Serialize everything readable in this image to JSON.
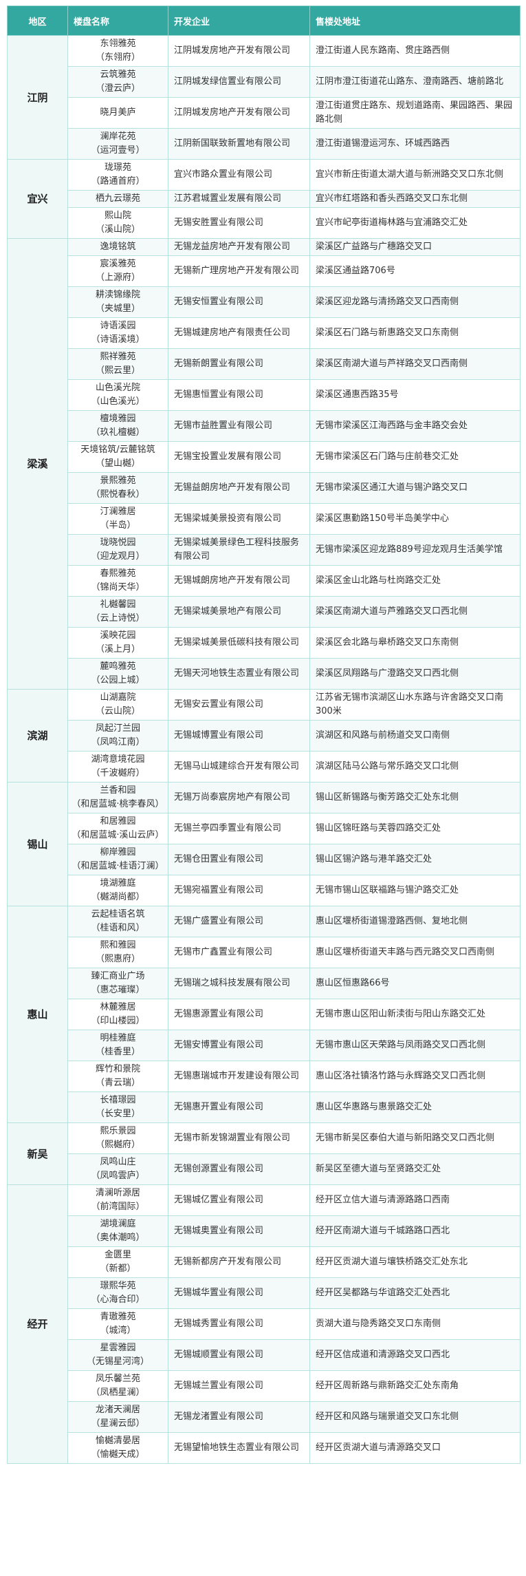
{
  "header": {
    "region": "地区",
    "name": "楼盘名称",
    "developer": "开发企业",
    "address": "售楼处地址"
  },
  "groups": [
    {
      "region": "江阴",
      "rows": [
        {
          "name": [
            "东翎雅苑",
            "（东翎府）"
          ],
          "developer": "江阴城发房地产开发有限公司",
          "address": "澄江街道人民东路南、贯庄路西侧"
        },
        {
          "name": [
            "云筑雅苑",
            "（澄云庐）"
          ],
          "developer": "江阴城发绿信置业有限公司",
          "address": "江阴市澄江街道花山路东、澄南路西、塘前路北"
        },
        {
          "name": [
            "晓月美庐"
          ],
          "developer": "江阴城发房地产开发有限公司",
          "address": "澄江街道贯庄路东、规划道路南、果园路西、果园路北侧"
        },
        {
          "name": [
            "澜岸花苑",
            "（运河壹号）"
          ],
          "developer": "江阴新国联致新置地有限公司",
          "address": "澄江街道锡澄运河东、环城西路西"
        }
      ]
    },
    {
      "region": "宜兴",
      "rows": [
        {
          "name": [
            "珑璟苑",
            "（路通首府）"
          ],
          "developer": "宜兴市路众置业有限公司",
          "address": "宜兴市新庄街道太湖大道与新洲路交叉口东北侧"
        },
        {
          "name": [
            "栖九云璟苑"
          ],
          "developer": "江苏君城置业发展有限公司",
          "address": "宜兴市红塔路和香头西路交叉口东北侧"
        },
        {
          "name": [
            "熙山院",
            "（溪山院）"
          ],
          "developer": "无锡安胜置业有限公司",
          "address": "宜兴市屺亭街道梅林路与宜浦路交汇处"
        }
      ]
    },
    {
      "region": "梁溪",
      "rows": [
        {
          "name": [
            "逸境铭筑"
          ],
          "developer": "无锡龙益房地产开发有限公司",
          "address": "梁溪区广益路与广穗路交叉口"
        },
        {
          "name": [
            "宸溪雅苑",
            "（上源府）"
          ],
          "developer": "无锡新广理房地产开发有限公司",
          "address": "梁溪区通益路706号"
        },
        {
          "name": [
            "耕渎锦缘院",
            "（夹城里）"
          ],
          "developer": "无锡安恒置业有限公司",
          "address": "梁溪区迎龙路与清扬路交叉口西南侧"
        },
        {
          "name": [
            "诗语溪园",
            "（诗语溪境）"
          ],
          "developer": "无锡城建房地产有限责任公司",
          "address": "梁溪区石门路与新惠路交叉口东南侧"
        },
        {
          "name": [
            "熙祥雅苑",
            "（熙云里）"
          ],
          "developer": "无锡新朗置业有限公司",
          "address": "梁溪区南湖大道与芦祥路交叉口西南侧"
        },
        {
          "name": [
            "山色溪光院",
            "（山色溪光）"
          ],
          "developer": "无锡惠恒置业有限公司",
          "address": "梁溪区通惠西路35号"
        },
        {
          "name": [
            "檀境雅园",
            "（玖礼檀樾）"
          ],
          "developer": "无锡市益胜置业有限公司",
          "address": "无锡市梁溪区江海西路与金丰路交会处"
        },
        {
          "name": [
            "天境铭筑/云麓铭筑",
            "（望山樾）"
          ],
          "developer": "无锡宝投置业发展有限公司",
          "address": "无锡市梁溪区石门路与庄前巷交汇处"
        },
        {
          "name": [
            "景熙雅苑",
            "（熙悦春秋）"
          ],
          "developer": "无锡益朗房地产开发有限公司",
          "address": "无锡市梁溪区通江大道与锡沪路交叉口"
        },
        {
          "name": [
            "汀澜雅居",
            "（半岛）"
          ],
          "developer": "无锡梁城美景投资有限公司",
          "address": "梁溪区惠勤路150号半岛美学中心"
        },
        {
          "name": [
            "珑晓悦园",
            "（迎龙观月）"
          ],
          "developer": "无锡梁城美景绿色工程科技服务有限公司",
          "address": "无锡市梁溪区迎龙路889号迎龙观月生活美学馆"
        },
        {
          "name": [
            "春熙雅苑",
            "（锦尚天华）"
          ],
          "developer": "无锡城朗房地产开发有限公司",
          "address": "梁溪区金山北路与杜岗路交汇处"
        },
        {
          "name": [
            "礼樾馨园",
            "（云上诗悦）"
          ],
          "developer": "无锡梁城美景地产有限公司",
          "address": "梁溪区南湖大道与芦雅路交叉口西北侧"
        },
        {
          "name": [
            "溪映花园",
            "（溪上月）"
          ],
          "developer": "无锡梁城美景低碳科技有限公司",
          "address": "梁溪区会北路与皋桥路交叉口东南侧"
        },
        {
          "name": [
            "麓鸣雅苑",
            "（公园上城）"
          ],
          "developer": "无锡天河地铁生态置业有限公司",
          "address": "梁溪区凤翔路与广澄路交叉口西北侧"
        }
      ]
    },
    {
      "region": "滨湖",
      "rows": [
        {
          "name": [
            "山湖嘉院",
            "（云山院）"
          ],
          "developer": "无锡安云置业有限公司",
          "address": "江苏省无锡市滨湖区山水东路与许舍路交叉口南300米"
        },
        {
          "name": [
            "凤起汀兰园",
            "（凤鸣江南）"
          ],
          "developer": "无锡城博置业有限公司",
          "address": "滨湖区和风路与前杨道交叉口南侧"
        },
        {
          "name": [
            "湖湾意境花园",
            "（千波樾府）"
          ],
          "developer": "无锡马山城建综合开发有限公司",
          "address": "滨湖区陆马公路与常乐路交叉口北侧"
        }
      ]
    },
    {
      "region": "锡山",
      "rows": [
        {
          "name": [
            "兰香和园",
            "（和居蓝城·桃李春风）"
          ],
          "developer": "无锡万尚泰宸房地产有限公司",
          "address": "锡山区新锡路与衡芳路交汇处东北侧"
        },
        {
          "name": [
            "和居雅园",
            "（和居蓝城·溪山云庐）"
          ],
          "developer": "无锡兰亭四季置业有限公司",
          "address": "锡山区锦旺路与芙蓉四路交汇处"
        },
        {
          "name": [
            "柳岸雅园",
            "（和居蓝城·桂语汀澜）"
          ],
          "developer": "无锡仓田置业有限公司",
          "address": "锡山区锡沪路与港羊路交汇处"
        },
        {
          "name": [
            "境湖雅庭",
            "（樾湖尚都）"
          ],
          "developer": "无锡宛福置业有限公司",
          "address": "无锡市锡山区联福路与锡沪路交汇处"
        }
      ]
    },
    {
      "region": "惠山",
      "rows": [
        {
          "name": [
            "云起桂语名筑",
            "（桂语和风）"
          ],
          "developer": "无锡广盛置业有限公司",
          "address": "惠山区堰桥街道锡澄路西侧、复地北侧"
        },
        {
          "name": [
            "熙和雅园",
            "（熙惠府）"
          ],
          "developer": "无锡市广鑫置业有限公司",
          "address": "惠山区堰桥街道天丰路与西元路交叉口西南侧"
        },
        {
          "name": [
            "臻汇商业广场",
            "（惠芯璀璨）"
          ],
          "developer": "无锡瑞之城科技发展有限公司",
          "address": "惠山区恒惠路66号"
        },
        {
          "name": [
            "林麓雅居",
            "（印山楼园）"
          ],
          "developer": "无锡惠源置业有限公司",
          "address": "无锡市惠山区阳山新渎街与阳山东路交汇处"
        },
        {
          "name": [
            "明桂雅庭",
            "（桂香里）"
          ],
          "developer": "无锡安博置业有限公司",
          "address": "无锡市惠山区天荣路与凤雨路交叉口西北侧"
        },
        {
          "name": [
            "辉竹和景院",
            "（青云瑞）"
          ],
          "developer": "无锡惠瑞城市开发建设有限公司",
          "address": "惠山区洛社镇洛竹路与永辉路交叉口西北侧"
        },
        {
          "name": [
            "长禧璟园",
            "（长安里）"
          ],
          "developer": "无锡惠开置业有限公司",
          "address": "惠山区华惠路与惠景路交汇处"
        }
      ]
    },
    {
      "region": "新吴",
      "rows": [
        {
          "name": [
            "熙乐景园",
            "（熙樾府）"
          ],
          "developer": "无锡市新发锦湖置业有限公司",
          "address": "无锡市新吴区泰伯大道与新阳路交叉口西北侧"
        },
        {
          "name": [
            "凤鸣山庄",
            "（凤鸣雲庐）"
          ],
          "developer": "无锡创源置业有限公司",
          "address": "新吴区至德大道与至贤路交汇处"
        }
      ]
    },
    {
      "region": "经开",
      "rows": [
        {
          "name": [
            "清澜听源居",
            "（前湾国际）"
          ],
          "developer": "无锡城亿置业有限公司",
          "address": "经开区立信大道与清源路路口西南"
        },
        {
          "name": [
            "湖境澜庭",
            "（奥体潮鸣）"
          ],
          "developer": "无锡城奥置业有限公司",
          "address": "经开区南湖大道与千城路路口西北"
        },
        {
          "name": [
            "金匮里",
            "（新都）"
          ],
          "developer": "无锡新都房产开发有限公司",
          "address": "经开区贡湖大道与壤铁桥路交汇处东北"
        },
        {
          "name": [
            "璟熙华苑",
            "（心海合印）"
          ],
          "developer": "无锡城华置业有限公司",
          "address": "经开区吴都路与华谊路交汇处西北"
        },
        {
          "name": [
            "青璈雅苑",
            "（城湾）"
          ],
          "developer": "无锡城秀置业有限公司",
          "address": "贡湖大道与隐秀路交叉口东南侧"
        },
        {
          "name": [
            "星雲雅园",
            "（无锡星河湾）"
          ],
          "developer": "无锡城顺置业有限公司",
          "address": "经开区信成道和清源路交叉口西北"
        },
        {
          "name": [
            "凤乐馨兰苑",
            "（凤栖星澜）"
          ],
          "developer": "无锡城兰置业有限公司",
          "address": "经开区周新路与鼎新路交汇处东南角"
        },
        {
          "name": [
            "龙渚天澜居",
            "（星澜云邸）"
          ],
          "developer": "无锡龙渚置业有限公司",
          "address": "经开区和风路与瑞景道交叉口东北侧"
        },
        {
          "name": [
            "愉樾清晏居",
            "（愉樾天成）"
          ],
          "developer": "无锡望愉地铁生态置业有限公司",
          "address": "经开区贡湖大道与清源路交叉口"
        }
      ]
    }
  ]
}
